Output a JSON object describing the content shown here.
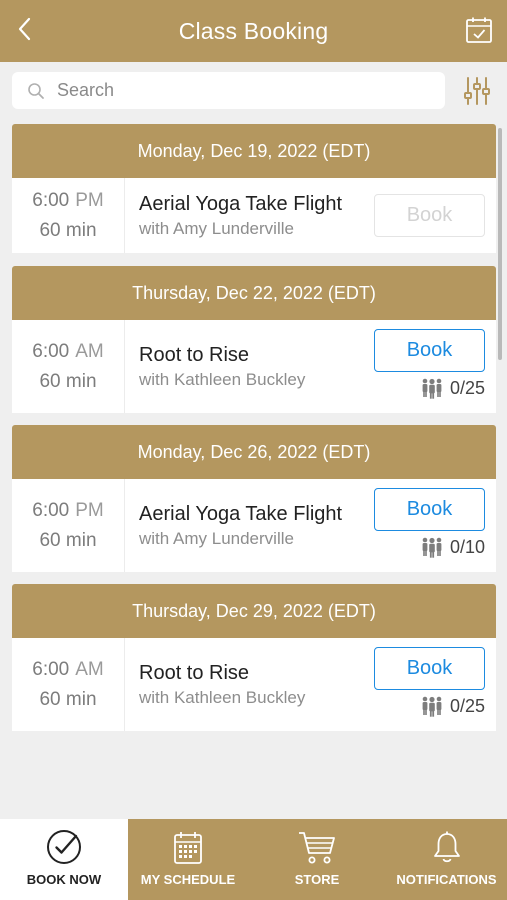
{
  "header": {
    "title": "Class Booking",
    "back_icon": "chevron-left-icon",
    "calendar_icon": "calendar-check-icon"
  },
  "search": {
    "placeholder": "Search",
    "value": ""
  },
  "colors": {
    "brand": "#b4975f",
    "accent": "#1d8be0",
    "background": "#efefef"
  },
  "days": [
    {
      "date": "Monday, Dec 19, 2022 (EDT)",
      "sessions": [
        {
          "time": "6:00",
          "ampm": "PM",
          "duration": "60 min",
          "class": "Aerial Yoga Take Flight",
          "instructor": "with Amy Lunderville",
          "book_label": "Book",
          "book_enabled": false,
          "capacity": ""
        }
      ]
    },
    {
      "date": "Thursday, Dec 22, 2022 (EDT)",
      "sessions": [
        {
          "time": "6:00",
          "ampm": "AM",
          "duration": "60 min",
          "class": "Root to Rise",
          "instructor": "with Kathleen Buckley",
          "book_label": "Book",
          "book_enabled": true,
          "capacity": "0/25"
        }
      ]
    },
    {
      "date": "Monday, Dec 26, 2022 (EDT)",
      "sessions": [
        {
          "time": "6:00",
          "ampm": "PM",
          "duration": "60 min",
          "class": "Aerial Yoga Take Flight",
          "instructor": "with Amy Lunderville",
          "book_label": "Book",
          "book_enabled": true,
          "capacity": "0/10"
        }
      ]
    },
    {
      "date": "Thursday, Dec 29, 2022 (EDT)",
      "sessions": [
        {
          "time": "6:00",
          "ampm": "AM",
          "duration": "60 min",
          "class": "Root to Rise",
          "instructor": "with Kathleen Buckley",
          "book_label": "Book",
          "book_enabled": true,
          "capacity": "0/25"
        }
      ]
    }
  ],
  "nav": [
    {
      "label": "BOOK NOW",
      "icon": "check-circle-icon",
      "active": true
    },
    {
      "label": "MY SCHEDULE",
      "icon": "calendar-icon",
      "active": false
    },
    {
      "label": "STORE",
      "icon": "cart-icon",
      "active": false
    },
    {
      "label": "NOTIFICATIONS",
      "icon": "bell-icon",
      "active": false
    }
  ]
}
